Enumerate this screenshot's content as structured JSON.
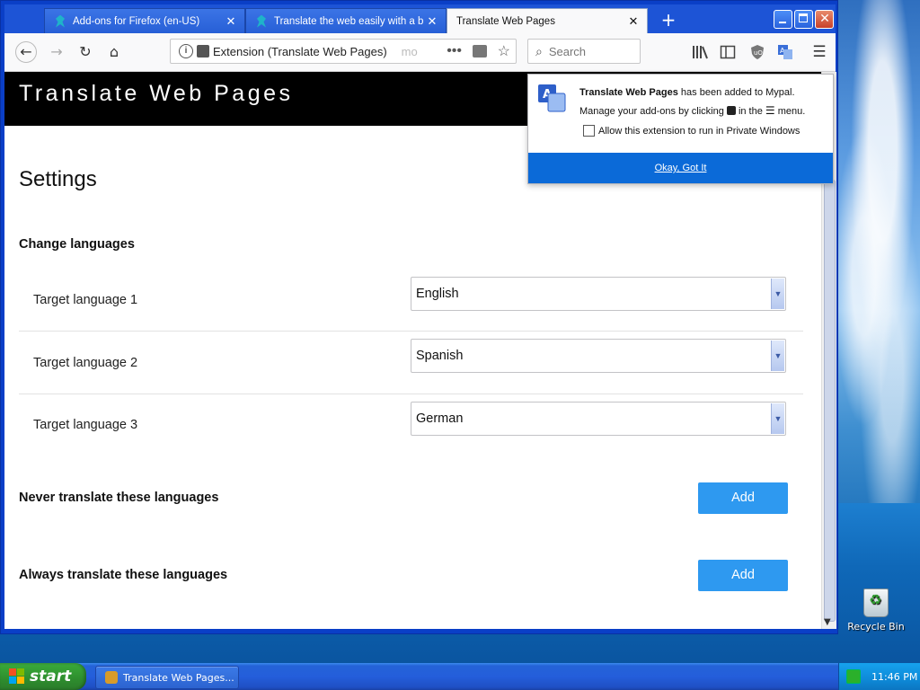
{
  "browser": {
    "tabs": [
      {
        "label": "Add-ons for Firefox (en-US)"
      },
      {
        "label": "Translate the web easily with a br"
      },
      {
        "label": "Translate Web Pages"
      }
    ],
    "url": {
      "identity": "Extension (Translate Web Pages)",
      "trailing": "mo"
    },
    "search_placeholder": "Search"
  },
  "page": {
    "brand": "Translate Web Pages",
    "settings_title": "Settings",
    "change_languages": "Change languages",
    "targets": [
      {
        "label": "Target language 1",
        "value": "English"
      },
      {
        "label": "Target language 2",
        "value": "Spanish"
      },
      {
        "label": "Target language 3",
        "value": "German"
      }
    ],
    "never_translate": "Never translate these languages",
    "always_translate": "Always translate these languages",
    "add_label": "Add"
  },
  "popup": {
    "ext_name": "Translate Web Pages",
    "line1_rest": "has been added to Mypal.",
    "line2_a": "Manage your add-ons by clicking",
    "line2_b": "in the",
    "line2_c": "menu.",
    "checkbox_label": "Allow this extension to run in Private Windows",
    "ok_label": "Okay, Got It"
  },
  "desktop": {
    "recycle_bin": "Recycle Bin"
  },
  "taskbar": {
    "start_label": "start",
    "task_label": "Translate Web Pages...",
    "clock": "11:46 PM"
  },
  "colors": {
    "accent": "#0b6ad8",
    "add_button": "#2e99f0",
    "xp_taskbar": "#245edb",
    "start_green": "#2e8d2e"
  }
}
